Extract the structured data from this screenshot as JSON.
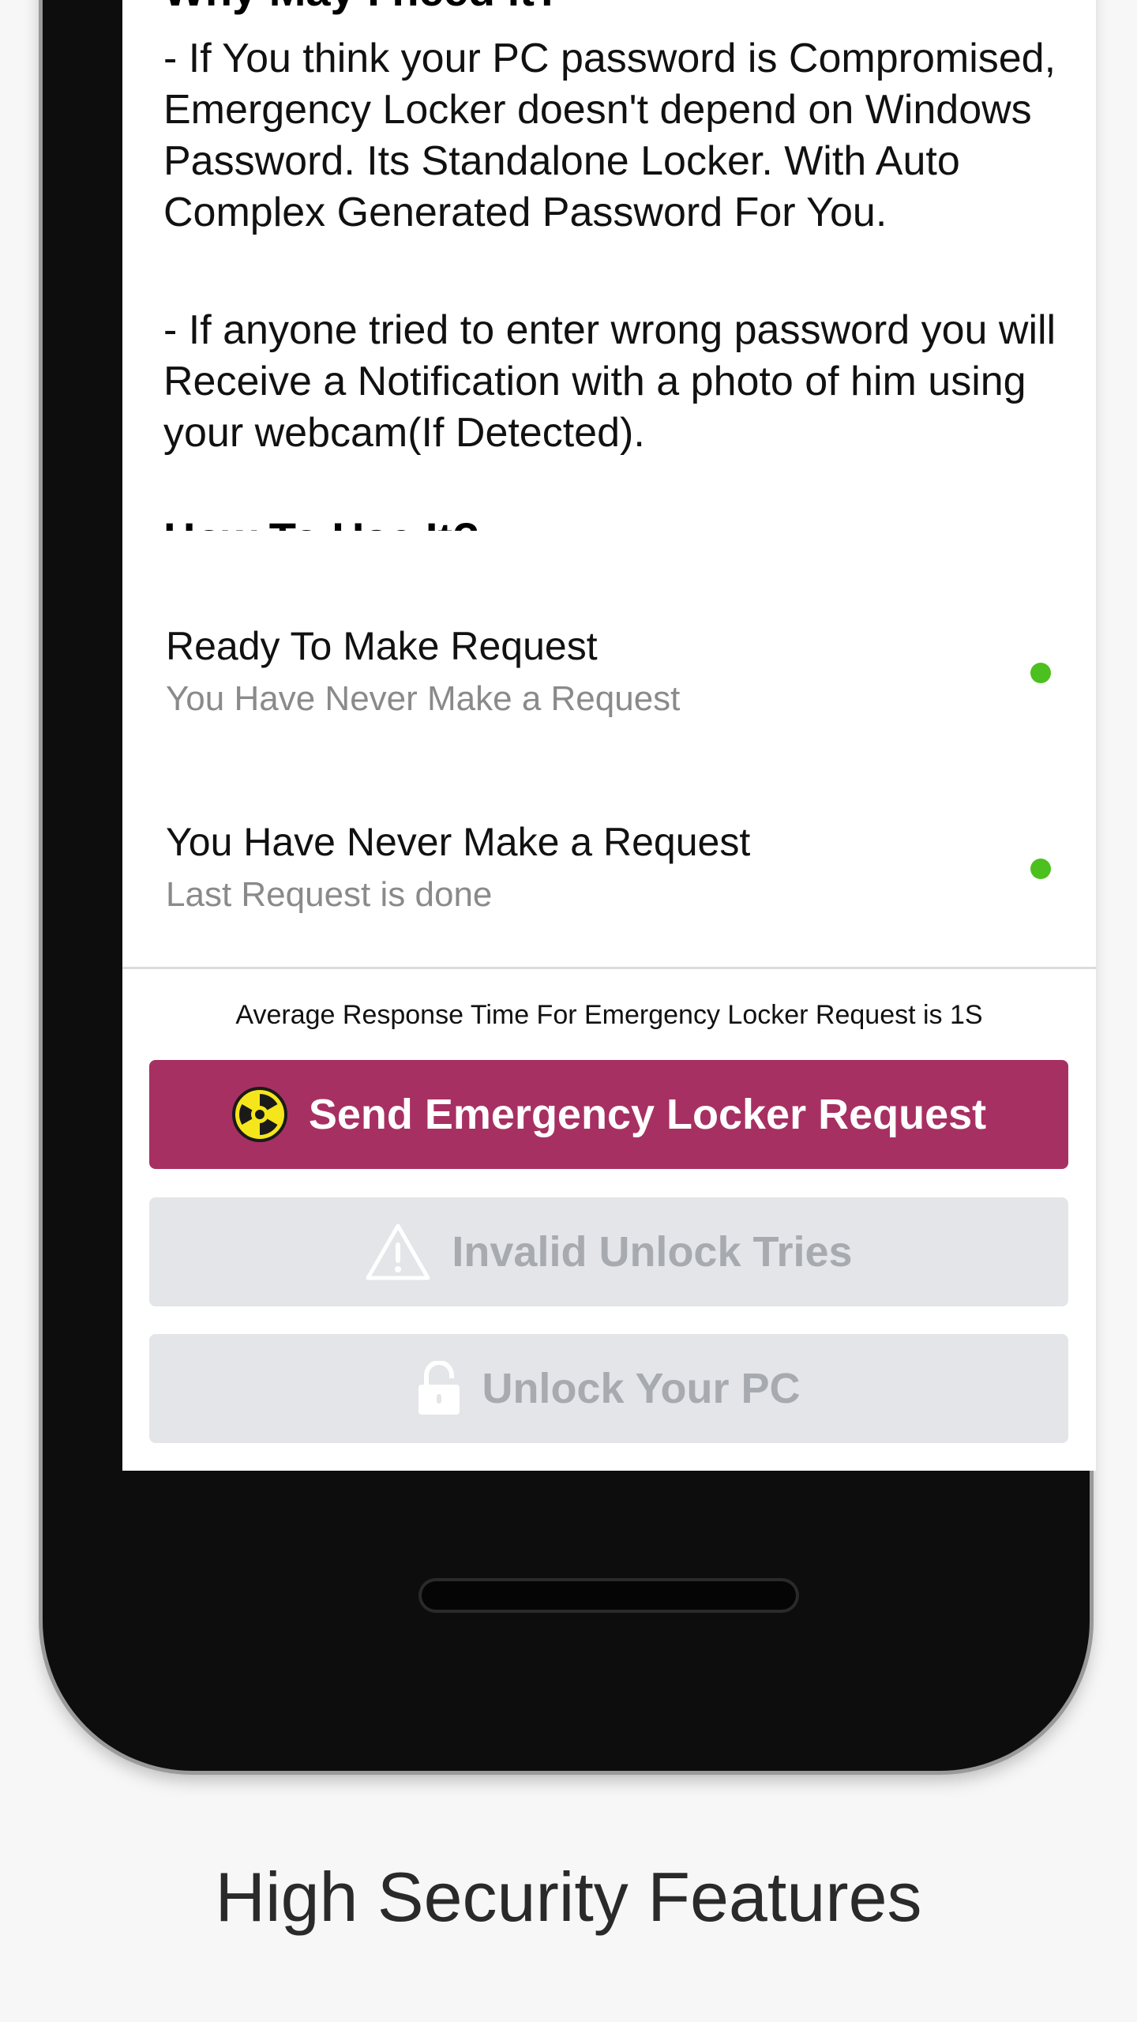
{
  "content": {
    "heading": "Why May I need it?",
    "paragraphs": [
      "- If You think your PC password is Compromised, Emergency Locker doesn't depend on Windows Password. Its Standalone Locker. With Auto Complex Generated Password For You.",
      "- If anyone tried to enter wrong password you will Receive a Notification with a photo of him using your webcam(If Detected)."
    ],
    "next_heading": "How To Use It?"
  },
  "status_items": [
    {
      "title": "Ready To Make Request",
      "subtitle": "You Have Never Make a Request",
      "dot_color": "#4cc01e"
    },
    {
      "title": "You Have Never Make a Request",
      "subtitle": "Last Request is done",
      "dot_color": "#4cc01e"
    }
  ],
  "response_time": "Average Response Time For Emergency Locker Request is 1S",
  "buttons": {
    "send": {
      "label": "Send Emergency Locker Request",
      "icon": "radiation-icon",
      "color": "#a73062"
    },
    "invalid": {
      "label": "Invalid Unlock Tries",
      "icon": "warning-triangle-icon",
      "color": "#e3e5e8"
    },
    "unlock": {
      "label": "Unlock Your PC",
      "icon": "unlock-icon",
      "color": "#e3e5e8"
    }
  },
  "caption": "High Security Features"
}
